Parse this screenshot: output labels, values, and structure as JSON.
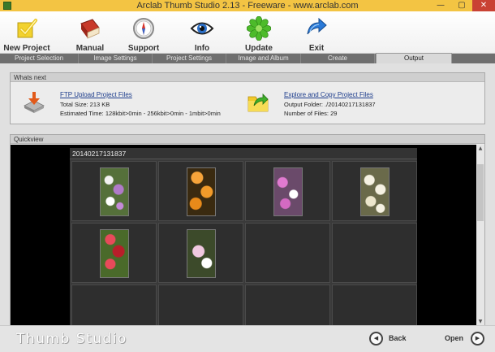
{
  "window": {
    "title": "Arclab Thumb Studio 2.13 - Freeware - www.arclab.com",
    "minimize_glyph": "—",
    "maximize_glyph": "▢",
    "close_glyph": "✕"
  },
  "toolbar": {
    "buttons": [
      {
        "label": "New Project",
        "icon": "new-project-icon"
      },
      {
        "label": "Manual",
        "icon": "book-icon"
      },
      {
        "label": "Support",
        "icon": "compass-icon"
      },
      {
        "label": "Info",
        "icon": "eye-icon"
      },
      {
        "label": "Update",
        "icon": "flower-icon"
      },
      {
        "label": "Exit",
        "icon": "exit-arrow-icon"
      }
    ]
  },
  "tabs": [
    {
      "label": "Project Selection",
      "active": false
    },
    {
      "label": "Image Settings",
      "active": false
    },
    {
      "label": "Project Settings",
      "active": false
    },
    {
      "label": "Image and Album Selection",
      "active": false
    },
    {
      "label": "Create",
      "active": false
    },
    {
      "label": "Output",
      "active": true
    }
  ],
  "whats_next": {
    "title": "Whats next",
    "ftp": {
      "link": "FTP Upload Project Files",
      "total_size": "Total Size: 213 KB",
      "estimated_time": "Estimated Time: 128kbit>0min - 256kbit>0min - 1mbit>0min",
      "icon": "ftp-upload-icon"
    },
    "explore": {
      "link": "Explore and Copy Project Files",
      "output_folder": "Output Folder: ./20140217131837",
      "number_of_files": "Number of Files: 29",
      "icon": "folder-explore-icon"
    }
  },
  "quickview": {
    "title": "Quickview",
    "gallery_title": "20140217131837",
    "thumbnails": [
      {
        "description": "purple and white daisies",
        "colors": [
          "#6a8a3a",
          "#b07ac8",
          "#f2f2f2"
        ]
      },
      {
        "description": "orange marigolds",
        "colors": [
          "#c76f12",
          "#f29b2a",
          "#3a2a10"
        ]
      },
      {
        "description": "pink mesembryanthemum flowers",
        "colors": [
          "#8a5a8a",
          "#e07ad0",
          "#ffffff"
        ]
      },
      {
        "description": "white daisies",
        "colors": [
          "#d8d2b8",
          "#f5f1e2",
          "#5a5a3a"
        ]
      },
      {
        "description": "red flowers",
        "colors": [
          "#b81e2a",
          "#e84a5a",
          "#4a6a2a"
        ]
      },
      {
        "description": "pink cosmos flowers",
        "colors": [
          "#3c4a2a",
          "#f0c8e0",
          "#ffffff"
        ]
      }
    ]
  },
  "footer": {
    "brand": "Thumb Studio",
    "back_label": "Back",
    "open_label": "Open",
    "back_glyph": "◀",
    "open_glyph": "▶"
  },
  "colors": {
    "titlebar": "#f3c443",
    "close": "#c94234",
    "tabbar": "#6f6f6f",
    "quickview_bg": "#000000",
    "link": "#1c3c8c"
  }
}
